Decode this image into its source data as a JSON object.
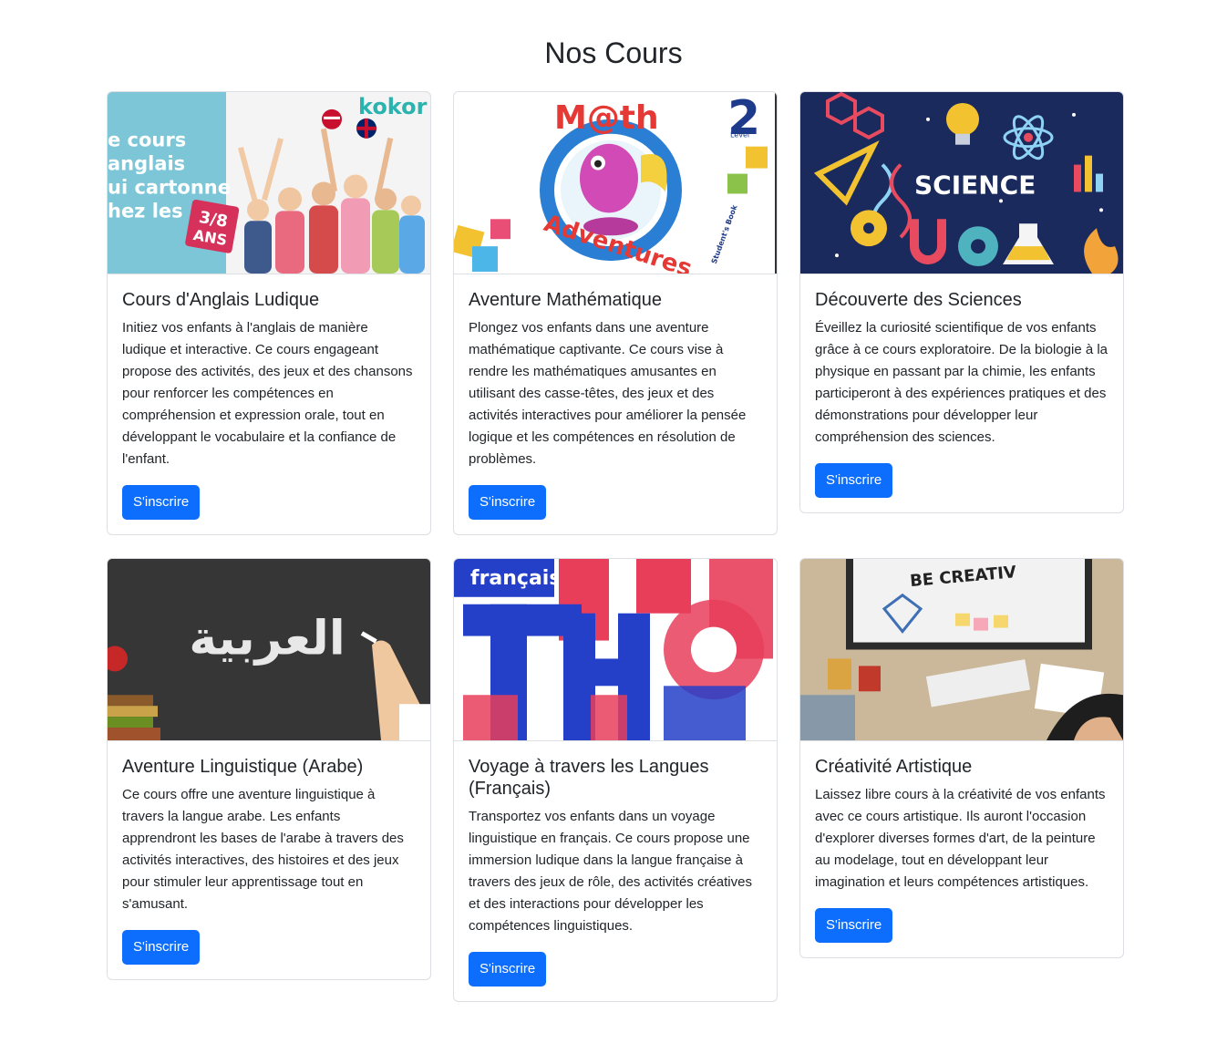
{
  "page": {
    "title": "Nos Cours"
  },
  "courses": [
    {
      "title": "Cours d'Anglais Ludique",
      "description": "Initiez vos enfants à l'anglais de manière ludique et interactive. Ce cours engageant propose des activités, des jeux et des chansons pour renforcer les compétences en compréhension et expression orale, tout en développant le vocabulaire et la confiance de l'enfant.",
      "button": "S'inscrire",
      "image_text": {
        "brand": "kokor",
        "line1": "e cours",
        "line2": "anglais",
        "line3": "ui cartonne",
        "line4": "hez les",
        "badge_top": "3/8",
        "badge_bottom": "ANS"
      }
    },
    {
      "title": "Aventure Mathématique",
      "description": "Plongez vos enfants dans une aventure mathématique captivante. Ce cours vise à rendre les mathématiques amusantes en utilisant des casse-têtes, des jeux et des activités interactives pour améliorer la pensée logique et les compétences en résolution de problèmes.",
      "button": "S'inscrire",
      "image_text": {
        "top": "M@th",
        "bottom": "Adventures",
        "level_number": "2",
        "level_label": "Level",
        "side": "Student's Book"
      }
    },
    {
      "title": "Découverte des Sciences",
      "description": "Éveillez la curiosité scientifique de vos enfants grâce à ce cours exploratoire. De la biologie à la physique en passant par la chimie, les enfants participeront à des expériences pratiques et des démonstrations pour développer leur compréhension des sciences.",
      "button": "S'inscrire",
      "image_text": {
        "label": "SCIENCE"
      }
    },
    {
      "title": "Aventure Linguistique (Arabe)",
      "description": "Ce cours offre une aventure linguistique à travers la langue arabe. Les enfants apprendront les bases de l'arabe à travers des activités interactives, des histoires et des jeux pour stimuler leur apprentissage tout en s'amusant.",
      "button": "S'inscrire",
      "image_text": {
        "label": "العربية"
      }
    },
    {
      "title": "Voyage à travers les Langues (Français)",
      "description": "Transportez vos enfants dans un voyage linguistique en français. Ce cours propose une immersion ludique dans la langue française à travers des jeux de rôle, des activités créatives et des interactions pour développer les compétences linguistiques.",
      "button": "S'inscrire",
      "image_text": {
        "label": "français"
      }
    },
    {
      "title": "Créativité Artistique",
      "description": "Laissez libre cours à la créativité de vos enfants avec ce cours artistique. Ils auront l'occasion d'explorer diverses formes d'art, de la peinture au modelage, tout en développant leur imagination et leurs compétences artistiques.",
      "button": "S'inscrire",
      "image_text": {
        "label": "BE CREATIV"
      }
    }
  ]
}
